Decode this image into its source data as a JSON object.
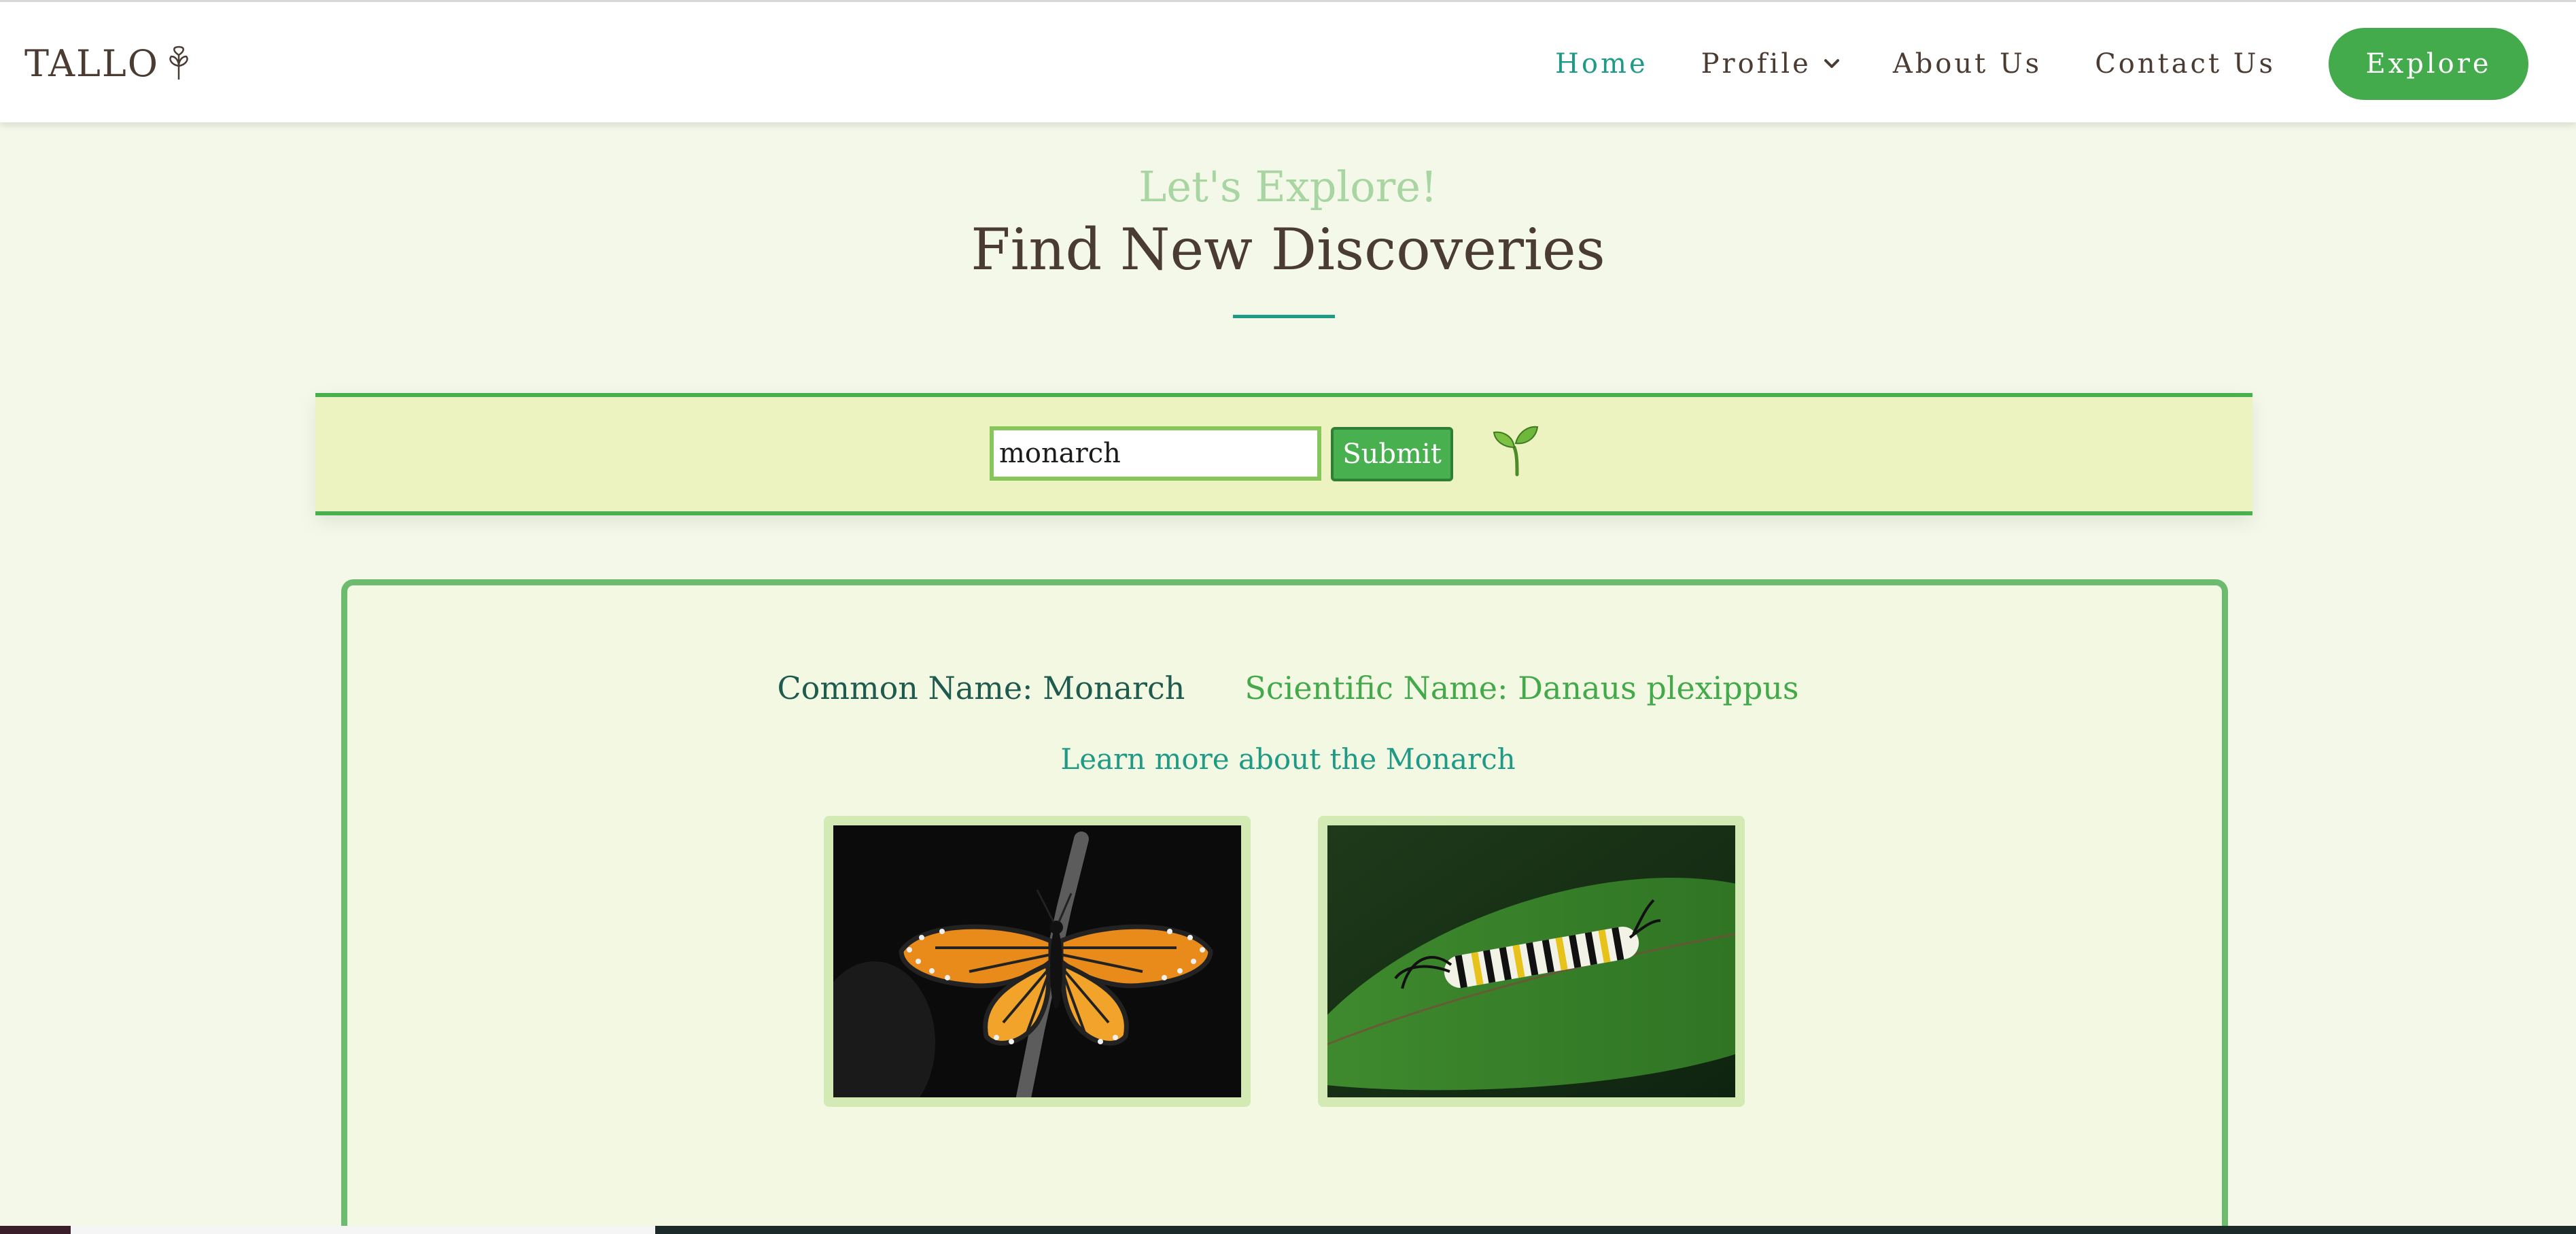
{
  "header": {
    "logo_text": "TALLO",
    "logo_icon": "leaf-icon",
    "nav": {
      "home": "Home",
      "profile": "Profile",
      "about": "About Us",
      "contact": "Contact Us"
    },
    "explore_label": "Explore",
    "colors": {
      "active_link": "#1e9a86",
      "button": "#43ab4b",
      "text": "#4a3b33"
    }
  },
  "hero": {
    "subtitle": "Let's Explore!",
    "title": "Find New Discoveries"
  },
  "search": {
    "value": "monarch",
    "submit_label": "Submit",
    "icon": "sprout-icon"
  },
  "result": {
    "common_name": "Common Name: Monarch",
    "scientific_name": "Scientific Name: Danaus plexippus",
    "learn_more": "Learn more about the Monarch",
    "images": [
      {
        "subject": "monarch butterfly"
      },
      {
        "subject": "monarch caterpillar"
      }
    ]
  },
  "colors": {
    "page_bg": "#f4f8e9",
    "band_bg": "#ecf2c0",
    "green_accent": "#48b04f",
    "teal_accent": "#1e9a86"
  }
}
